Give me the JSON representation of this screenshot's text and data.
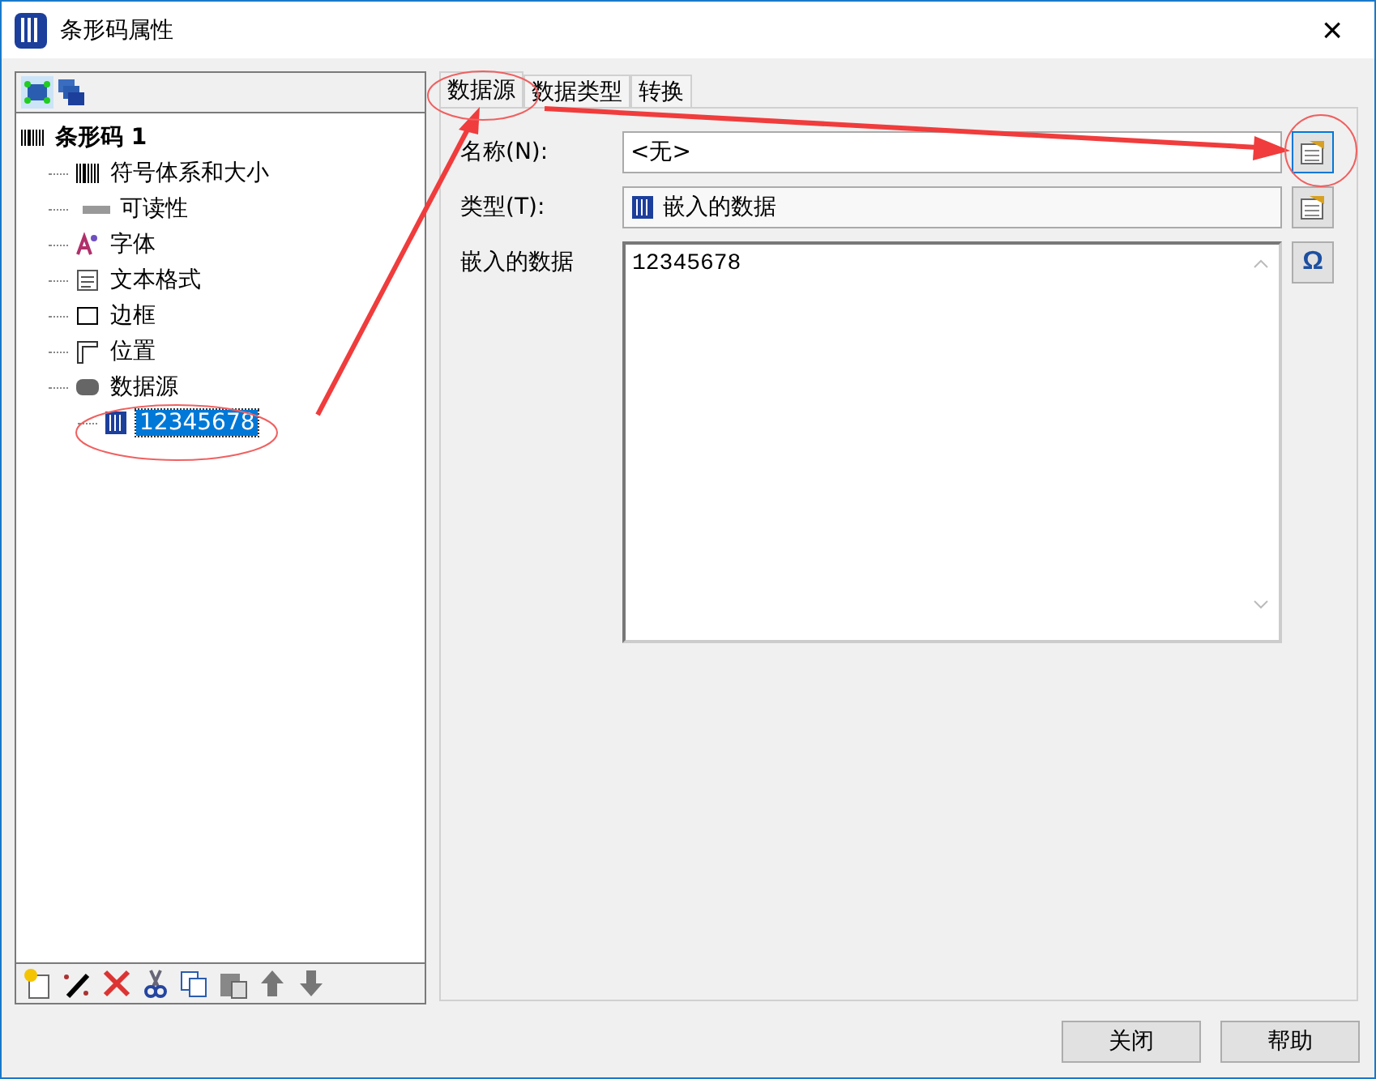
{
  "window": {
    "title": "条形码属性",
    "close": "×"
  },
  "tree": {
    "label": "条形码 1",
    "selected": false,
    "children": [
      {
        "label": "符号体系和大小",
        "selected": false
      },
      {
        "label": "可读性",
        "selected": false
      },
      {
        "label": "字体",
        "selected": false
      },
      {
        "label": "文本格式",
        "selected": false
      },
      {
        "label": "边框",
        "selected": false
      },
      {
        "label": "位置",
        "selected": false
      },
      {
        "label": "数据源",
        "selected": false,
        "children": [
          {
            "label": "12345678",
            "selected": true
          }
        ]
      }
    ]
  },
  "tabs": [
    {
      "label": "数据源",
      "selected": true
    },
    {
      "label": "数据类型",
      "selected": false
    },
    {
      "label": "转换",
      "selected": false
    }
  ],
  "form": {
    "name": {
      "label": "名称(N):",
      "value": "<无>"
    },
    "type": {
      "label": "类型(T):",
      "value": "嵌入的数据"
    },
    "data": {
      "label": "嵌入的数据",
      "value": "12345678"
    },
    "omega": "Ω"
  },
  "buttons": [
    {
      "label": "关闭"
    },
    {
      "label": "帮助"
    }
  ]
}
